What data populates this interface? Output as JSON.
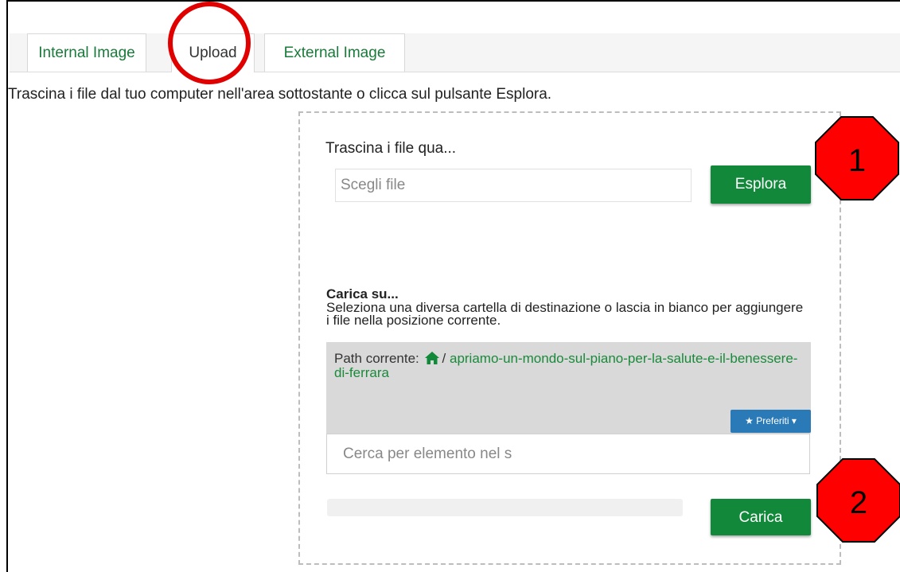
{
  "tabs": [
    {
      "label": "Internal Image"
    },
    {
      "label": "Upload"
    },
    {
      "label": "External Image"
    }
  ],
  "instructions": "Trascina i file dal tuo computer nell'area sottostante o clicca sul pulsante Esplora.",
  "dropzone": {
    "drag_label": "Trascina i file qua...",
    "file_placeholder": "Scegli file",
    "explore_label": "Esplora"
  },
  "upload_to": {
    "title": "Carica su...",
    "description": "Seleziona una diversa cartella di destinazione o lascia in bianco per aggiungere i file nella posizione corrente."
  },
  "path": {
    "label": "Path corrente:",
    "separator": "/",
    "current": "apriamo-un-mondo-sul-piano-per-la-salute-e-il-benessere-di-ferrara",
    "favorites_label": "Preferiti"
  },
  "search": {
    "placeholder": "Cerca per elemento nel s"
  },
  "upload_button": "Carica",
  "progress_value": 0,
  "annotations": {
    "badge1": "1",
    "badge2": "2"
  },
  "colors": {
    "green": "#12883a",
    "blue": "#2a7ab8",
    "annotation_red": "#e00000"
  },
  "icons": {
    "home": "home-icon",
    "favorites": "star-icon",
    "dropdown": "caret-down-icon"
  }
}
